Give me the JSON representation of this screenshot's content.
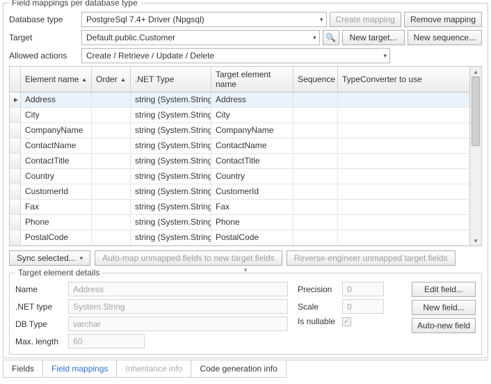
{
  "group": {
    "title": "Field mappings per database type"
  },
  "dbtype": {
    "label": "Database type",
    "value": "PostgreSql 7.4+ Driver (Npgsql)"
  },
  "target": {
    "label": "Target",
    "value": "Default.public.Customer"
  },
  "allowed": {
    "label": "Allowed actions",
    "value": "Create / Retrieve / Update / Delete"
  },
  "buttons": {
    "createMapping": "Create mapping",
    "removeMapping": "Remove mapping",
    "newTarget": "New target...",
    "newSequence": "New sequence...",
    "syncSelected": "Sync selected...",
    "autoMap": "Auto-map unmapped fields to new target fields",
    "reverse": "Reverse-engineer unmapped target fields",
    "editField": "Edit field...",
    "newField": "New field...",
    "autoNewField": "Auto-new field"
  },
  "columns": {
    "elementName": "Element name",
    "order": "Order",
    "netType": ".NET Type",
    "targetElement": "Target element name",
    "sequence": "Sequence",
    "typeConverter": "TypeConverter to use"
  },
  "rows": [
    {
      "elem": "Address",
      "type": "string (System.String)",
      "target": "Address",
      "selected": true
    },
    {
      "elem": "City",
      "type": "string (System.String)",
      "target": "City"
    },
    {
      "elem": "CompanyName",
      "type": "string (System.String)",
      "target": "CompanyName"
    },
    {
      "elem": "ContactName",
      "type": "string (System.String)",
      "target": "ContactName"
    },
    {
      "elem": "ContactTitle",
      "type": "string (System.String)",
      "target": "ContactTitle"
    },
    {
      "elem": "Country",
      "type": "string (System.String)",
      "target": "Country"
    },
    {
      "elem": "CustomerId",
      "type": "string (System.String)",
      "target": "CustomerId"
    },
    {
      "elem": "Fax",
      "type": "string (System.String)",
      "target": "Fax"
    },
    {
      "elem": "Phone",
      "type": "string (System.String)",
      "target": "Phone"
    },
    {
      "elem": "PostalCode",
      "type": "string (System.String)",
      "target": "PostalCode"
    }
  ],
  "details": {
    "title": "Target element details",
    "nameLabel": "Name",
    "name": "Address",
    "netTypeLabel": ".NET type",
    "netType": "System.String",
    "dbTypeLabel": "DB Type",
    "dbType": "varchar",
    "maxLenLabel": "Max. length",
    "maxLen": "60",
    "precisionLabel": "Precision",
    "precision": "0",
    "scaleLabel": "Scale",
    "scale": "0",
    "nullableLabel": "Is nullable",
    "nullable": true
  },
  "tabs": {
    "fields": "Fields",
    "mappings": "Field mappings",
    "inheritance": "Inheritance info",
    "codegen": "Code generation info"
  }
}
